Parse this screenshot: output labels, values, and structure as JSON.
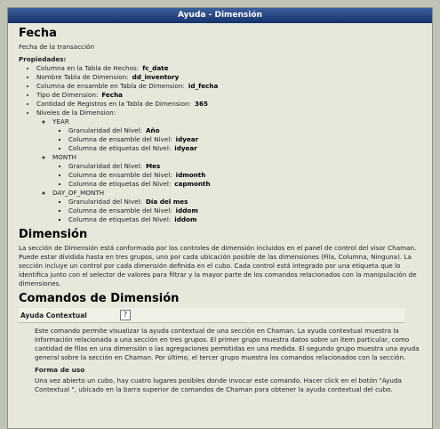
{
  "window": {
    "title": "Ayuda - Dimensión"
  },
  "fecha": {
    "heading": "Fecha",
    "description": "Fecha de la transacción",
    "props_title": "Propiedades:",
    "props": [
      {
        "label": "Columna en la Tabla de Hechos:",
        "value": "fc_date"
      },
      {
        "label": "Nombre Tabla de Dimension:",
        "value": "dd_inventory"
      },
      {
        "label": "Columna de ensamble en Tabla de Dimension:",
        "value": "id_fecha"
      },
      {
        "label": "Tipo de Dimension:",
        "value": "Fecha"
      },
      {
        "label": "Cantidad de Registros en la Tabla de Dimension:",
        "value": "365"
      }
    ],
    "levels_label": "Niveles de la Dimension:",
    "levels": [
      {
        "name": "YEAR",
        "granularity_label": "Granularidad del Nivel:",
        "granularity": "Año",
        "join_label": "Columna de ensamble del Nivel:",
        "join": "idyear",
        "tag_label": "Columna de etiquetas del Nivel:",
        "tag": "idyear"
      },
      {
        "name": "MONTH",
        "granularity_label": "Granularidad del Nivel:",
        "granularity": "Mes",
        "join_label": "Columna de ensamble del Nivel:",
        "join": "idmonth",
        "tag_label": "Columna de etiquetas del Nivel:",
        "tag": "capmonth"
      },
      {
        "name": "DAY_OF_MONTH",
        "granularity_label": "Granularidad del Nivel:",
        "granularity": "Día del mes",
        "join_label": "Columna de ensamble del Nivel:",
        "join": "iddom",
        "tag_label": "Columna de etiquetas del Nivel:",
        "tag": "iddom"
      }
    ]
  },
  "dimension": {
    "heading": "Dimensión",
    "text": "La sección de Dimensión está conformada por los controles de dimensión incluidos en el panel de control del visor Chaman. Puede estar dividida hasta en tres grupos, uno por cada ubicación posible de las dimensiones (Fila, Columna, Ninguna). La sección incluye un control por cada dimensión definida en el cubo. Cada control está integrado por una etiqueta que lo identifica junto con el selector de valores para filtrar y la mayor parte de los comandos relacionados con la manipulación de dimensiones."
  },
  "comandos": {
    "heading": "Comandos de Dimensión",
    "context_label": "Ayuda Contextual",
    "help_icon": "?",
    "text": "Este comando permite visualizar la ayuda contextual de una sección en Chaman. La ayuda contextual muestra la información relacionada a una sección en tres grupos. El primer grupo muestra datos sobre un ítem particular, como cantidad de filas en una dimensión o las agregaciones permitidas en una medida. El segundo grupo muestra una ayuda general sobre la sección en Chaman. Por último, el tercer grupo muestra los comandos relacionados con la sección.",
    "usage_heading": "Forma de uso",
    "usage_text": "Una vez abierto un cubo, hay cuatro lugares posibles donde invocar este comando. Hacer click en el botón \"Ayuda Contextual \", ubicado en la barra superior de comandos de Chaman para obtener la ayuda contextual del cubo."
  }
}
